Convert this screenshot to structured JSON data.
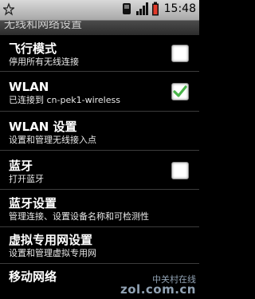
{
  "status_bar": {
    "time": "15:48",
    "icons": [
      "star-icon",
      "sim-icon",
      "signal-icon",
      "battery-icon"
    ]
  },
  "title": "无线和网络设置",
  "settings": {
    "airplane": {
      "title": "飞行模式",
      "summary": "停用所有无线连接",
      "checked": false
    },
    "wlan": {
      "title": "WLAN",
      "summary": "已连接到 cn-pek1-wireless",
      "checked": true
    },
    "wlan_settings": {
      "title": "WLAN 设置",
      "summary": "设置和管理无线接入点"
    },
    "bluetooth": {
      "title": "蓝牙",
      "summary": "打开蓝牙",
      "checked": false
    },
    "bluetooth_settings": {
      "title": "蓝牙设置",
      "summary": "管理连接、设置设备名称和可检测性"
    },
    "vpn_settings": {
      "title": "虚拟专用网设置",
      "summary": "设置和管理虚拟专用网"
    },
    "mobile_networks": {
      "title": "移动网络"
    }
  },
  "watermark": {
    "line1": "中关村在线",
    "line2": "zol.com.cn"
  },
  "colors": {
    "checkmark": "#49b449",
    "status_bar": "#c4c4c4"
  }
}
